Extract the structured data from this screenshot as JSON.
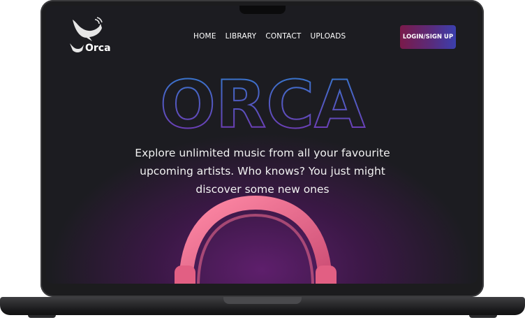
{
  "brand": {
    "name": "Orca"
  },
  "nav": {
    "items": [
      {
        "label": "HOME"
      },
      {
        "label": "LIBRARY"
      },
      {
        "label": "CONTACT"
      },
      {
        "label": "UPLOADS"
      }
    ]
  },
  "auth": {
    "label": "LOGIN/SIGN UP"
  },
  "hero": {
    "title": "ORCA",
    "tagline": "Explore unlimited music from all your favourite upcoming artists. Who knows? You just might discover some new ones"
  },
  "colors": {
    "background": "#1b1b1f",
    "accent_gradient_start": "#7a1a4a",
    "accent_gradient_end": "#3b3fae",
    "title_outline_top": "#2f7fd1",
    "title_outline_bottom": "#7a2fb0",
    "headphones": "#f06a8c"
  },
  "icons": {
    "logo": "orca-whale-icon"
  }
}
